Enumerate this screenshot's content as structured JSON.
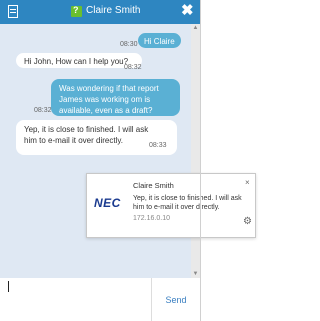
{
  "window": {
    "title": "Claire Smith",
    "doc_icon": "document-icon",
    "logo_icon": "app-logo-icon",
    "close_icon": "close-icon",
    "close_glyph": "✖",
    "titlebar_color": "#2e86c1",
    "chat_bg": "#dfe8f3",
    "outgoing_bubble_color": "#5ab0d4",
    "incoming_bubble_color": "#ffffff"
  },
  "background_text": "s",
  "messages": [
    {
      "direction": "out",
      "text": "Hi Claire",
      "time": "08:30"
    },
    {
      "direction": "in",
      "text": "Hi John, How can I help you?",
      "time": "08:32"
    },
    {
      "direction": "out",
      "text": "Was wondering if that report James was working om is available, even as a draft?",
      "time": "08:32"
    },
    {
      "direction": "in",
      "text": "Yep, it is close to finished. I will ask him to e-mail it over directly.",
      "time": "08:33"
    }
  ],
  "scrollbar": {
    "up_glyph": "▲",
    "down_glyph": "▼"
  },
  "notification": {
    "logo_text": "NEC",
    "sender": "Claire Smith",
    "message": "Yep, it is close to finished. I will ask him to e-mail it over directly.",
    "ip": "172.16.0.10",
    "close_glyph": "×",
    "settings_glyph": "⚙",
    "close_icon": "close-icon",
    "settings_icon": "gear-icon"
  },
  "composer": {
    "send_label": "Send"
  }
}
